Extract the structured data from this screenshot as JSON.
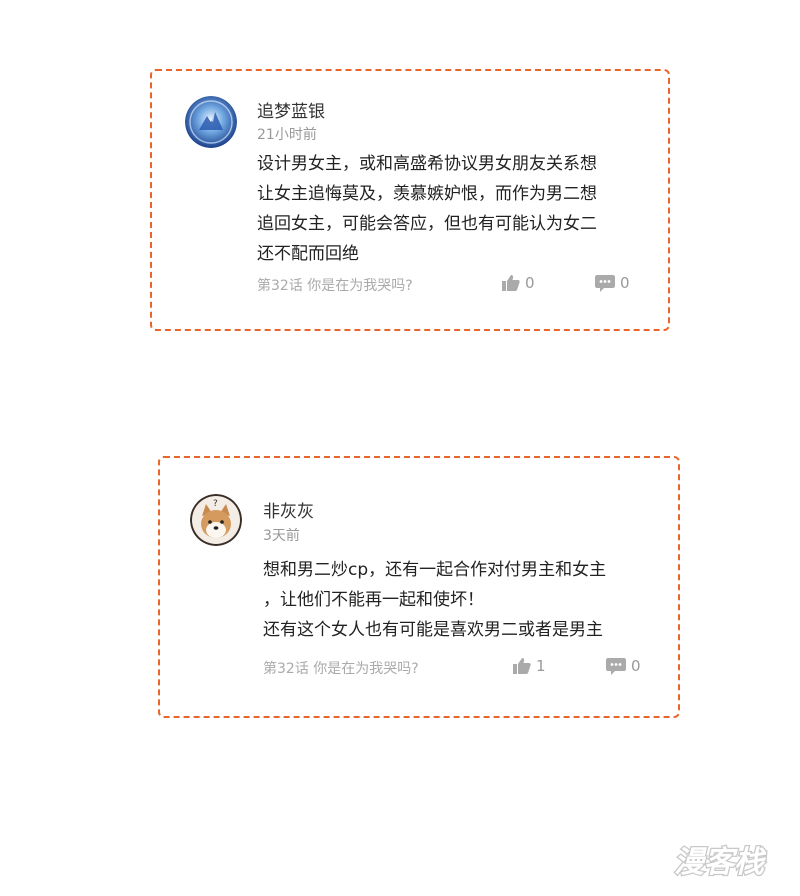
{
  "comments": [
    {
      "username": "追梦蓝银",
      "time": "21小时前",
      "content": "设计男女主，或和高盛希协议男女朋友关系想\n让女主追悔莫及，羡慕嫉妒恨，而作为男二想\n追回女主，可能会答应，但也有可能认为女二\n还不配而回绝",
      "chapter": "第32话 你是在为我哭吗?",
      "likes": "0",
      "replies": "0"
    },
    {
      "username": "非灰灰",
      "time": "3天前",
      "content": "想和男二炒cp，还有一起合作对付男主和女主\n，让他们不能再一起和使坏！\n还有这个女人也有可能是喜欢男二或者是男主",
      "chapter": "第32话 你是在为我哭吗?",
      "likes": "1",
      "replies": "0"
    }
  ],
  "watermark": "漫客栈",
  "colors": {
    "border": "#e8652b",
    "muted": "#999999",
    "text": "#222222"
  },
  "icons": [
    "thumbs-up-icon",
    "comment-icon"
  ]
}
